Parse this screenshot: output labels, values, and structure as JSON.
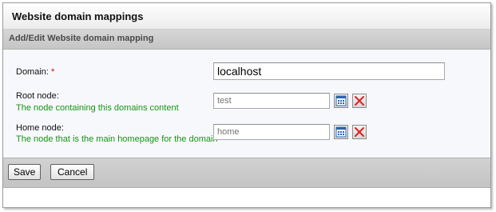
{
  "header": {
    "title": "Website domain mappings"
  },
  "panel": {
    "title": "Add/Edit Website domain mapping"
  },
  "form": {
    "domain": {
      "label": "Domain:",
      "required_marker": "*",
      "value": "localhost"
    },
    "root_node": {
      "label": "Root node:",
      "hint": "The node containing this domains content",
      "placeholder": "test",
      "picker_icon": "calendar-grid-icon",
      "clear_icon": "red-x-icon"
    },
    "home_node": {
      "label": "Home node:",
      "hint": "The node that is the main homepage for the domain",
      "placeholder": "home",
      "picker_icon": "calendar-grid-icon",
      "clear_icon": "red-x-icon"
    }
  },
  "buttons": {
    "save": "Save",
    "cancel": "Cancel"
  },
  "colors": {
    "hint_green": "#169416",
    "required_red": "#d40000",
    "clear_red": "#e02020",
    "picker_blue": "#2a64b8"
  }
}
